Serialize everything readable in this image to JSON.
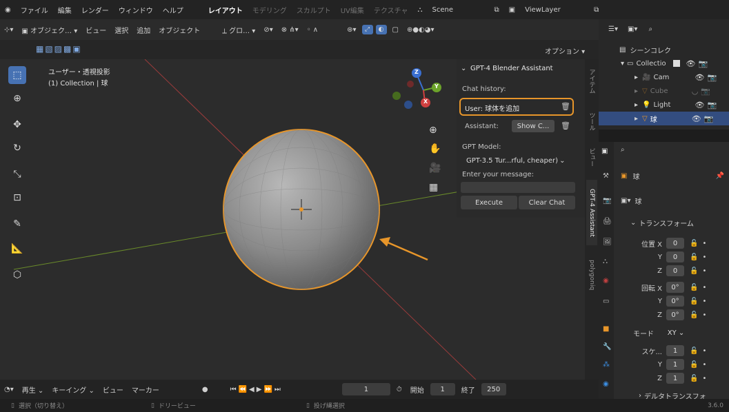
{
  "topbar": {
    "menus": [
      "ファイル",
      "編集",
      "レンダー",
      "ウィンドウ",
      "ヘルプ"
    ],
    "workspaces": [
      "レイアウト",
      "モデリング",
      "スカルプト",
      "UV編集",
      "テクスチャ"
    ],
    "scene_label": "Scene",
    "viewlayer_label": "ViewLayer"
  },
  "vpheader": {
    "mode": "オブジェク…",
    "menus": [
      "ビュー",
      "選択",
      "追加",
      "オブジェクト"
    ],
    "transform_orient": "グロ…",
    "options_label": "オプション"
  },
  "viewport": {
    "view_name": "ユーザー・透視投影",
    "collection_info": "(1) Collection | 球",
    "gizmo_axes": {
      "x": "X",
      "y": "Y",
      "z": "Z"
    }
  },
  "npanel": {
    "title": "GPT-4 Blender Assistant",
    "chat_history_label": "Chat history:",
    "user_message": "User: 球体を追加",
    "assistant_label": "Assistant:",
    "show_button": "Show C...",
    "model_label": "GPT Model:",
    "model_value": "GPT-3.5 Tur...rful, cheaper)",
    "enter_label": "Enter your message:",
    "execute_button": "Execute",
    "clear_button": "Clear Chat",
    "highlight_color": "#e8962a"
  },
  "ntabs": [
    "アイテム",
    "ツール",
    "ビュー",
    "GPT-4 Assistant",
    "polygoniq"
  ],
  "outliner": {
    "root": "シーンコレク",
    "collection": "Collectio",
    "items": [
      "Cam",
      "Cube",
      "Light",
      "球"
    ]
  },
  "props": {
    "object_name": "球",
    "mesh_name": "球",
    "section": "トランスフォーム",
    "location_label": "位置 X",
    "rotation_label": "回転 X",
    "scale_label": "スケ...",
    "mode_label": "モード",
    "mode_value": "XY",
    "location": [
      "0",
      "0",
      "0"
    ],
    "rotation": [
      "0°",
      "0°",
      "0°"
    ],
    "scale": [
      "1",
      "1",
      "1"
    ],
    "axis_y": "Y",
    "axis_z": "Z",
    "delta_label": "デルタトランスフォ"
  },
  "timeline": {
    "play_label": "再生",
    "keying_label": "キーイング",
    "view_label": "ビュー",
    "marker_label": "マーカー",
    "current_frame": "1",
    "start_label": "開始",
    "start_value": "1",
    "end_label": "終了",
    "end_value": "250"
  },
  "statusbar": {
    "select": "選択（切り替え）",
    "dolly": "ドリービュー",
    "lasso": "投げ縄選択",
    "version": "3.6.0"
  }
}
